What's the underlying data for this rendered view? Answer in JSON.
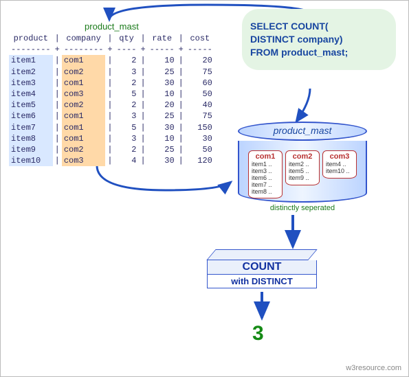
{
  "table": {
    "title": "product_mast",
    "headers": [
      "product",
      "company",
      "qty",
      "rate",
      "cost"
    ],
    "rows": [
      {
        "product": "item1",
        "company": "com1",
        "qty": 2,
        "rate": 10,
        "cost": 20
      },
      {
        "product": "item2",
        "company": "com2",
        "qty": 3,
        "rate": 25,
        "cost": 75
      },
      {
        "product": "item3",
        "company": "com1",
        "qty": 2,
        "rate": 30,
        "cost": 60
      },
      {
        "product": "item4",
        "company": "com3",
        "qty": 5,
        "rate": 10,
        "cost": 50
      },
      {
        "product": "item5",
        "company": "com2",
        "qty": 2,
        "rate": 20,
        "cost": 40
      },
      {
        "product": "item6",
        "company": "com1",
        "qty": 3,
        "rate": 25,
        "cost": 75
      },
      {
        "product": "item7",
        "company": "com1",
        "qty": 5,
        "rate": 30,
        "cost": 150
      },
      {
        "product": "item8",
        "company": "com1",
        "qty": 3,
        "rate": 10,
        "cost": 30
      },
      {
        "product": "item9",
        "company": "com2",
        "qty": 2,
        "rate": 25,
        "cost": 50
      },
      {
        "product": "item10",
        "company": "com3",
        "qty": 4,
        "rate": 30,
        "cost": 120
      }
    ]
  },
  "sql": {
    "l1": "SELECT COUNT(",
    "l2": "DISTINCT company)",
    "l3": "FROM product_mast;"
  },
  "cylinder": {
    "title": "product_mast",
    "groups": [
      {
        "name": "com1",
        "items": [
          "item1 ..",
          "item3 ..",
          "item6 ..",
          "item7 ..",
          "item8 .."
        ]
      },
      {
        "name": "com2",
        "items": [
          "item2 ..",
          "item5 ..",
          "item9 .."
        ]
      },
      {
        "name": "com3",
        "items": [
          "item4 ..",
          "item10 .."
        ]
      }
    ],
    "caption": "distinctly seperated"
  },
  "count": {
    "title": "COUNT",
    "sub": "with DISTINCT"
  },
  "result": "3",
  "attribution": "w3resource.com",
  "chart_data": {
    "type": "table",
    "operation": "SELECT COUNT(DISTINCT company) FROM product_mast",
    "input_columns": [
      "product",
      "company",
      "qty",
      "rate",
      "cost"
    ],
    "input_rows": [
      [
        "item1",
        "com1",
        2,
        10,
        20
      ],
      [
        "item2",
        "com2",
        3,
        25,
        75
      ],
      [
        "item3",
        "com1",
        2,
        30,
        60
      ],
      [
        "item4",
        "com3",
        5,
        10,
        50
      ],
      [
        "item5",
        "com2",
        2,
        20,
        40
      ],
      [
        "item6",
        "com1",
        3,
        25,
        75
      ],
      [
        "item7",
        "com1",
        5,
        30,
        150
      ],
      [
        "item8",
        "com1",
        3,
        10,
        30
      ],
      [
        "item9",
        "com2",
        2,
        25,
        50
      ],
      [
        "item10",
        "com3",
        4,
        30,
        120
      ]
    ],
    "distinct_companies": [
      "com1",
      "com2",
      "com3"
    ],
    "output": 3
  }
}
